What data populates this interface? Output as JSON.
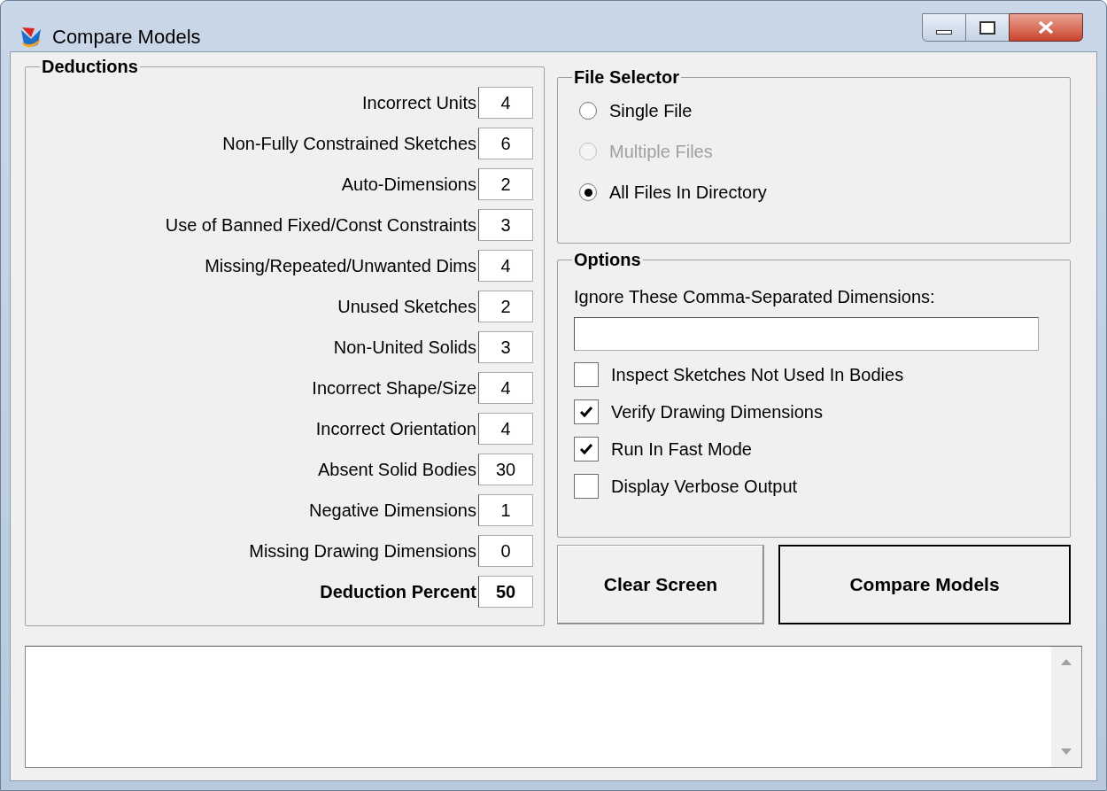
{
  "window": {
    "title": "Compare Models"
  },
  "deductions": {
    "title": "Deductions",
    "rows": [
      {
        "label": "Incorrect Units",
        "value": "4",
        "kind": "normal"
      },
      {
        "label": "Non-Fully Constrained Sketches",
        "value": "6",
        "kind": "normal"
      },
      {
        "label": "Auto-Dimensions",
        "value": "2",
        "kind": "normal"
      },
      {
        "label": "Use of Banned Fixed/Const Constraints",
        "value": "3",
        "kind": "normal"
      },
      {
        "label": "Missing/Repeated/Unwanted Dims",
        "value": "4",
        "kind": "normal"
      },
      {
        "label": "Unused Sketches",
        "value": "2",
        "kind": "normal"
      },
      {
        "label": "Non-United Solids",
        "value": "3",
        "kind": "normal"
      },
      {
        "label": "Incorrect Shape/Size",
        "value": "4",
        "kind": "normal"
      },
      {
        "label": "Incorrect Orientation",
        "value": "4",
        "kind": "normal"
      },
      {
        "label": "Absent Solid Bodies",
        "value": "30",
        "kind": "normal"
      },
      {
        "label": "Negative Dimensions",
        "value": "1",
        "kind": "normal"
      },
      {
        "label": "Missing Drawing Dimensions",
        "value": "0",
        "kind": "normal"
      },
      {
        "label": "Deduction Percent",
        "value": "50",
        "kind": "total"
      }
    ]
  },
  "file_selector": {
    "title": "File Selector",
    "options": [
      {
        "label": "Single File",
        "selected": false,
        "disabled": false
      },
      {
        "label": "Multiple Files",
        "selected": false,
        "disabled": true
      },
      {
        "label": "All Files In Directory",
        "selected": true,
        "disabled": false
      }
    ]
  },
  "options": {
    "title": "Options",
    "field_label": "Ignore These Comma-Separated Dimensions:",
    "checkboxes": [
      {
        "label": "Inspect Sketches Not Used In Bodies",
        "checked": false
      },
      {
        "label": "Verify Drawing Dimensions",
        "checked": true
      },
      {
        "label": "Run In Fast Mode",
        "checked": true
      },
      {
        "label": "Display Verbose Output",
        "checked": false
      }
    ]
  },
  "buttons": [
    {
      "label": "Clear Screen",
      "default": false
    },
    {
      "label": "Compare Models",
      "default": true
    }
  ]
}
